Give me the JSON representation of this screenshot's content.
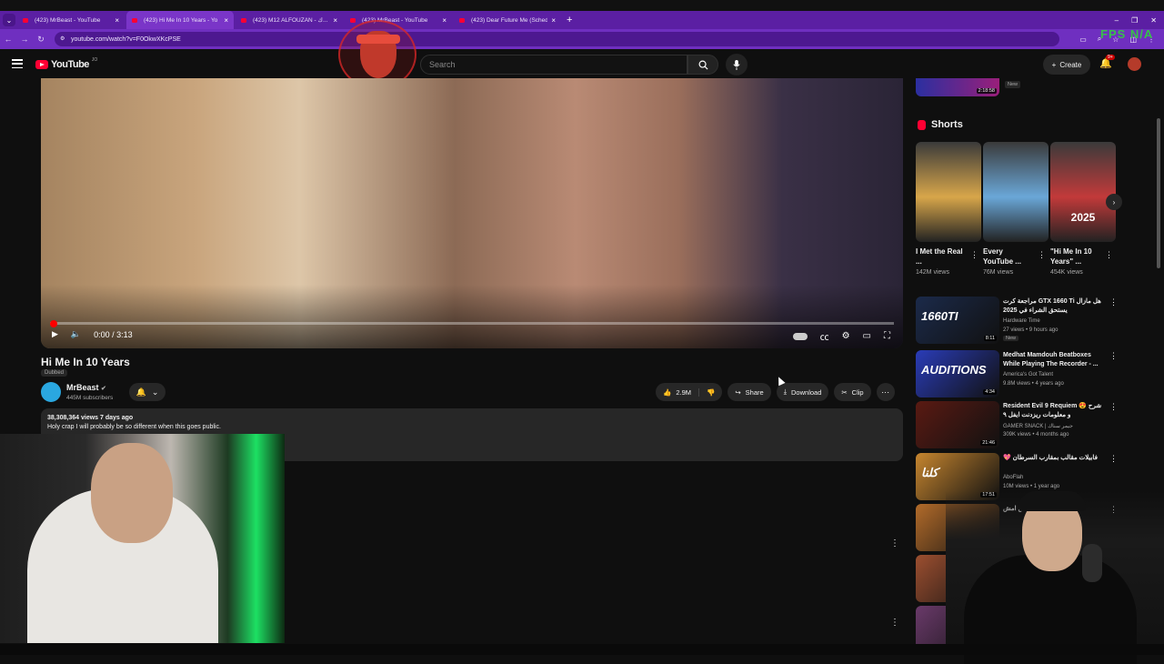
{
  "browser": {
    "tabs": [
      {
        "label": "(423) MrBeast - YouTube",
        "active": false
      },
      {
        "label": "(423) Hi Me In 10 Years - Yo",
        "active": true
      },
      {
        "label": "(423) M12 ALFOUZAN - ك...",
        "active": false
      },
      {
        "label": "(423) MrBeast - YouTube",
        "active": false
      },
      {
        "label": "(423) Dear Future Me (Schedul",
        "active": false
      }
    ],
    "new_tab": "+",
    "dropdown": "⌄",
    "window_controls": [
      "–",
      "❐",
      "✕"
    ],
    "url": "youtube.com/watch?v=F0OkwXKcPSE",
    "fps_overlay": "FPS N/A"
  },
  "header": {
    "logo_text": "YouTube",
    "logo_country": "JO",
    "search_placeholder": "Search",
    "create_label": "Create",
    "notification_count": "9+"
  },
  "player": {
    "time": "0:00 / 3:13",
    "progress": 0.0
  },
  "video": {
    "title": "Hi Me In 10 Years",
    "dubbed_label": "Dubbed",
    "channel_name": "MrBeast",
    "subscribers": "445M subscribers",
    "likes": "2.9M",
    "share_label": "Share",
    "download_label": "Download",
    "clip_label": "Clip",
    "views_line": "38,308,364 views  7 days ago",
    "description": "Holy crap I will probably be so different when this goes public."
  },
  "sidebar": {
    "top_duration": "2:18:58",
    "top_badge": "New",
    "shorts_title": "Shorts",
    "shorts": [
      {
        "title": "I Met the Real ...",
        "views": "142M views",
        "bg": "#d8a64a"
      },
      {
        "title": "Every YouTube ...",
        "views": "76M views",
        "bg": "#6aa7d8"
      },
      {
        "title": "\"Hi Me In 10 Years\" ...",
        "views": "454K views",
        "bg": "#c23a3a",
        "overlay": "2025"
      }
    ],
    "suggestions": [
      {
        "title": "مراجعة كرت GTX 1660 Ti هل مازال يستحق الشراء في 2025",
        "channel": "Hardware Time",
        "views": "27 views • 9 hours ago",
        "badge": "New",
        "duration": "8:11",
        "thumb_text": "1660TI",
        "bg": "#1b2a4a"
      },
      {
        "title": "Medhat Mamdouh Beatboxes While Playing The Recorder - ...",
        "channel": "America's Got Talent",
        "views": "9.8M views • 4 years ago",
        "duration": "4:34",
        "thumb_text": "AUDITIONS",
        "bg": "#2a3cb8"
      },
      {
        "title": "Resident Evil 9 Requiem 😍 شرح و معلومات ريزدنت ايفل ٩",
        "channel": "GAMER SNACK | جيمر سناك",
        "views": "309K views • 4 months ago",
        "duration": "21:46",
        "thumb_text": "",
        "bg": "#5a1a12"
      },
      {
        "title": "💖 فابيلات مقالب بمقارب السرطان",
        "channel": "AboFlah",
        "views": "10M views • 1 year ago",
        "duration": "17:51",
        "thumb_text": "كلنا",
        "bg": "#c7862f"
      },
      {
        "title": "مش امش",
        "channel": "",
        "views": "",
        "duration": "",
        "thumb_text": "",
        "bg": "#b26b2a"
      },
      {
        "title": "",
        "channel": "",
        "views": "",
        "duration": "",
        "thumb_text": "",
        "bg": "#9c4f30"
      },
      {
        "title": "",
        "channel": "",
        "views": "",
        "duration": "",
        "thumb_text": "",
        "bg": "#6a3a6a"
      }
    ]
  }
}
